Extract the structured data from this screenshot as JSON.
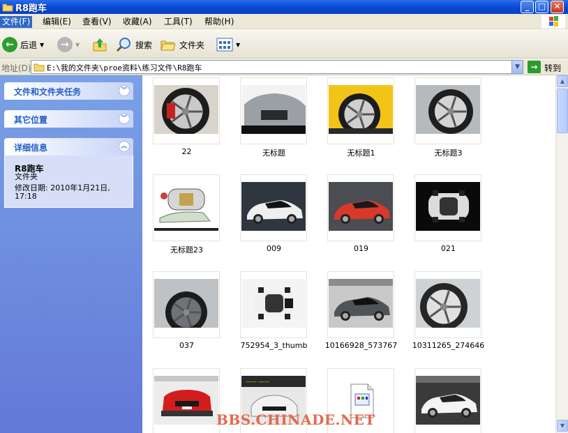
{
  "window": {
    "title": "R8跑车",
    "minimize_glyph": "_",
    "maximize_glyph": "□",
    "close_glyph": "✕"
  },
  "menu": [
    "文件(F)",
    "编辑(E)",
    "查看(V)",
    "收藏(A)",
    "工具(T)",
    "帮助(H)"
  ],
  "toolbar": {
    "back": "后退",
    "search": "搜索",
    "folders": "文件夹"
  },
  "address": {
    "label": "地址(D)",
    "path": "E:\\我的文件夹\\proe资料\\练习文件\\R8跑车",
    "go": "转到"
  },
  "sidebar": {
    "tasks_title": "文件和文件夹任务",
    "places_title": "其它位置",
    "details_title": "详细信息",
    "details": {
      "name": "R8跑车",
      "type": "文件夹",
      "modified_label": "修改日期: 2010年1月21日,",
      "modified_time": "17:18"
    }
  },
  "files": [
    {
      "name": "22",
      "theme": "wheel-red"
    },
    {
      "name": "无标题",
      "theme": "car-front-silver"
    },
    {
      "name": "无标题1",
      "theme": "wheel-yellow"
    },
    {
      "name": "无标题3",
      "theme": "wheel-silver"
    },
    {
      "name": "无标题23",
      "theme": "car-topview-sketch"
    },
    {
      "name": "009",
      "theme": "car-white-outdoor"
    },
    {
      "name": "019",
      "theme": "car-red"
    },
    {
      "name": "021",
      "theme": "car-topview-black"
    },
    {
      "name": "037",
      "theme": "wheel-dark"
    },
    {
      "name": "752954_3_thumb",
      "theme": "car-white-top"
    },
    {
      "name": "10166928_573767",
      "theme": "car-grey-show"
    },
    {
      "name": "10311265_274646",
      "theme": "wheel-close"
    },
    {
      "name": "",
      "theme": "car-red-front"
    },
    {
      "name": "",
      "theme": "car-poster"
    },
    {
      "name": "",
      "theme": "file-icon"
    },
    {
      "name": "",
      "theme": "car-white-show"
    }
  ],
  "watermark": "BBS.CHINADE.NET",
  "colors": {
    "titlebar": "#0a48d8",
    "sidebar": "#6f8fe0",
    "panel_title": "#215dc6"
  }
}
